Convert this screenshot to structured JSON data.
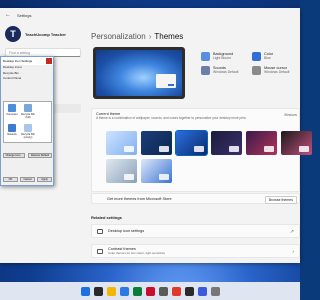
{
  "window": {
    "title": "Settings",
    "back_glyph": "←"
  },
  "profile": {
    "initial": "T",
    "name": "TeachUcomp Teacher",
    "sub": ""
  },
  "sidebar": {
    "search_placeholder": "Find a setting"
  },
  "breadcrumb": {
    "parent": "Personalization",
    "separator": "›",
    "current": "Themes"
  },
  "quick_settings": [
    {
      "label": "Background",
      "value": "Light Bloom",
      "color": "#5a8fe0"
    },
    {
      "label": "Color",
      "value": "Blue",
      "color": "#2f6fd6"
    },
    {
      "label": "Sounds",
      "value": "Windows Default",
      "color": "#6d7fa8"
    },
    {
      "label": "Mouse cursor",
      "value": "Windows Default",
      "color": "#8a8a8a"
    }
  ],
  "current_theme": {
    "label": "Current theme",
    "description": "A theme is a combination of wallpaper, sounds, and colors together to personalize your desktop more personally",
    "right_label": "Windows"
  },
  "themes": [
    {
      "name": "theme-light-bloom",
      "colors": [
        "#cfe3ff",
        "#7fb0f0"
      ]
    },
    {
      "name": "theme-dark-bloom",
      "colors": [
        "#1a3f7a",
        "#0d2550"
      ]
    },
    {
      "name": "theme-glow",
      "colors": [
        "#2a6fe0",
        "#0b2b6a"
      ]
    },
    {
      "name": "theme-captured-motion",
      "colors": [
        "#1b1d3a",
        "#3b2f6e"
      ]
    },
    {
      "name": "theme-sunrise",
      "colors": [
        "#3b1a4a",
        "#b0345a"
      ]
    },
    {
      "name": "theme-flow",
      "colors": [
        "#1a1a1a",
        "#c24f7e"
      ]
    },
    {
      "name": "theme-lake",
      "colors": [
        "#e0e8f0",
        "#8aa0b8"
      ]
    },
    {
      "name": "theme-contrast",
      "colors": [
        "#dfe9f7",
        "#3b74d6"
      ]
    }
  ],
  "store_row": {
    "label": "Get more themes from Microsoft Store",
    "button": "Browse themes"
  },
  "related": {
    "heading": "Related settings",
    "items": [
      {
        "label": "Desktop icon settings",
        "sub": ""
      },
      {
        "label": "Contrast themes",
        "sub": "Color themes for low vision, light sensitivity"
      }
    ]
  },
  "dialog": {
    "title": "Desktop Icon Settings",
    "line1": "Desktop icons",
    "line2": "Recycle Bin",
    "line3": "Control Panel",
    "icons": [
      {
        "label": "Computer"
      },
      {
        "label": "Recycle Bin (full)"
      },
      {
        "label": "Network"
      },
      {
        "label": "Recycle Bin (empty)"
      }
    ],
    "change_icon": "Change Icon...",
    "restore": "Restore Default",
    "ok": "OK",
    "cancel": "Cancel",
    "apply": "Apply"
  },
  "taskbar": {
    "apps": [
      "#1f6fe0",
      "#2a2a2a",
      "#f2b705",
      "#2a7ae2",
      "#0a7d3b",
      "#c8102e",
      "#5a5a5a",
      "#e03b2a",
      "#2a2a2a",
      "#3b5bdb",
      "#777777"
    ],
    "time": "",
    "date": ""
  }
}
